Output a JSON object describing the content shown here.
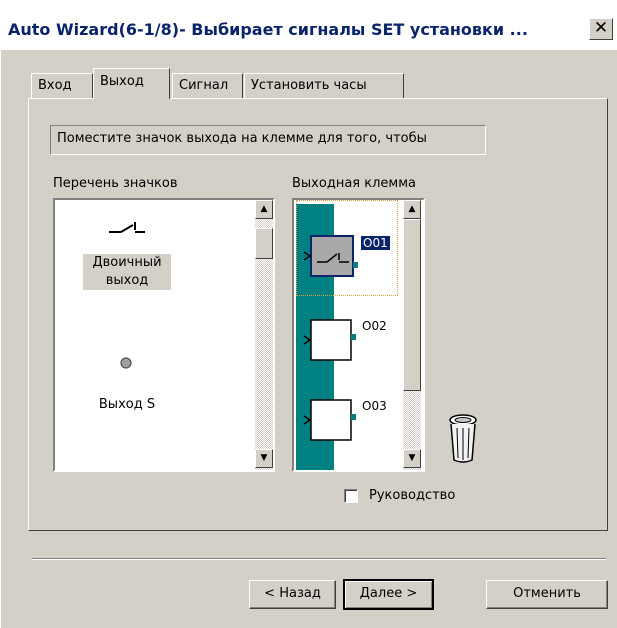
{
  "window": {
    "title": "Auto Wizard(6-1/8)- Выбирает сигналы SET установки ...",
    "close_glyph": "✕"
  },
  "tabs": [
    {
      "label": "Вход",
      "active": false
    },
    {
      "label": "Выход",
      "active": true
    },
    {
      "label": "Сигнал",
      "active": false
    },
    {
      "label": "Установить часы",
      "active": false
    }
  ],
  "description": "Поместите значок выхода на клемме для того, чтобы",
  "icon_list": {
    "label": "Перечень значков",
    "items": [
      {
        "label_line1": "Двоичный",
        "label_line2": "выход",
        "icon": "switch-icon",
        "selected": true
      },
      {
        "label_line1": "Выход S",
        "label_line2": "",
        "icon": "dot-icon",
        "selected": false
      }
    ]
  },
  "output_terminal": {
    "label": "Выходная клемма",
    "outputs": [
      {
        "name": "O01",
        "has_switch": true,
        "selected": true
      },
      {
        "name": "O02",
        "has_switch": false,
        "selected": false
      },
      {
        "name": "O03",
        "has_switch": false,
        "selected": false
      }
    ],
    "trash_icon": "trash-icon"
  },
  "manual_checkbox": {
    "label": "Руководство",
    "checked": false
  },
  "buttons": {
    "back": "< Назад",
    "next": "Далее >",
    "cancel": "Отменить"
  },
  "colors": {
    "title_text": "#0a246a",
    "bus": "#008080",
    "selection": "#0a246a",
    "face": "#d4d0c8"
  }
}
